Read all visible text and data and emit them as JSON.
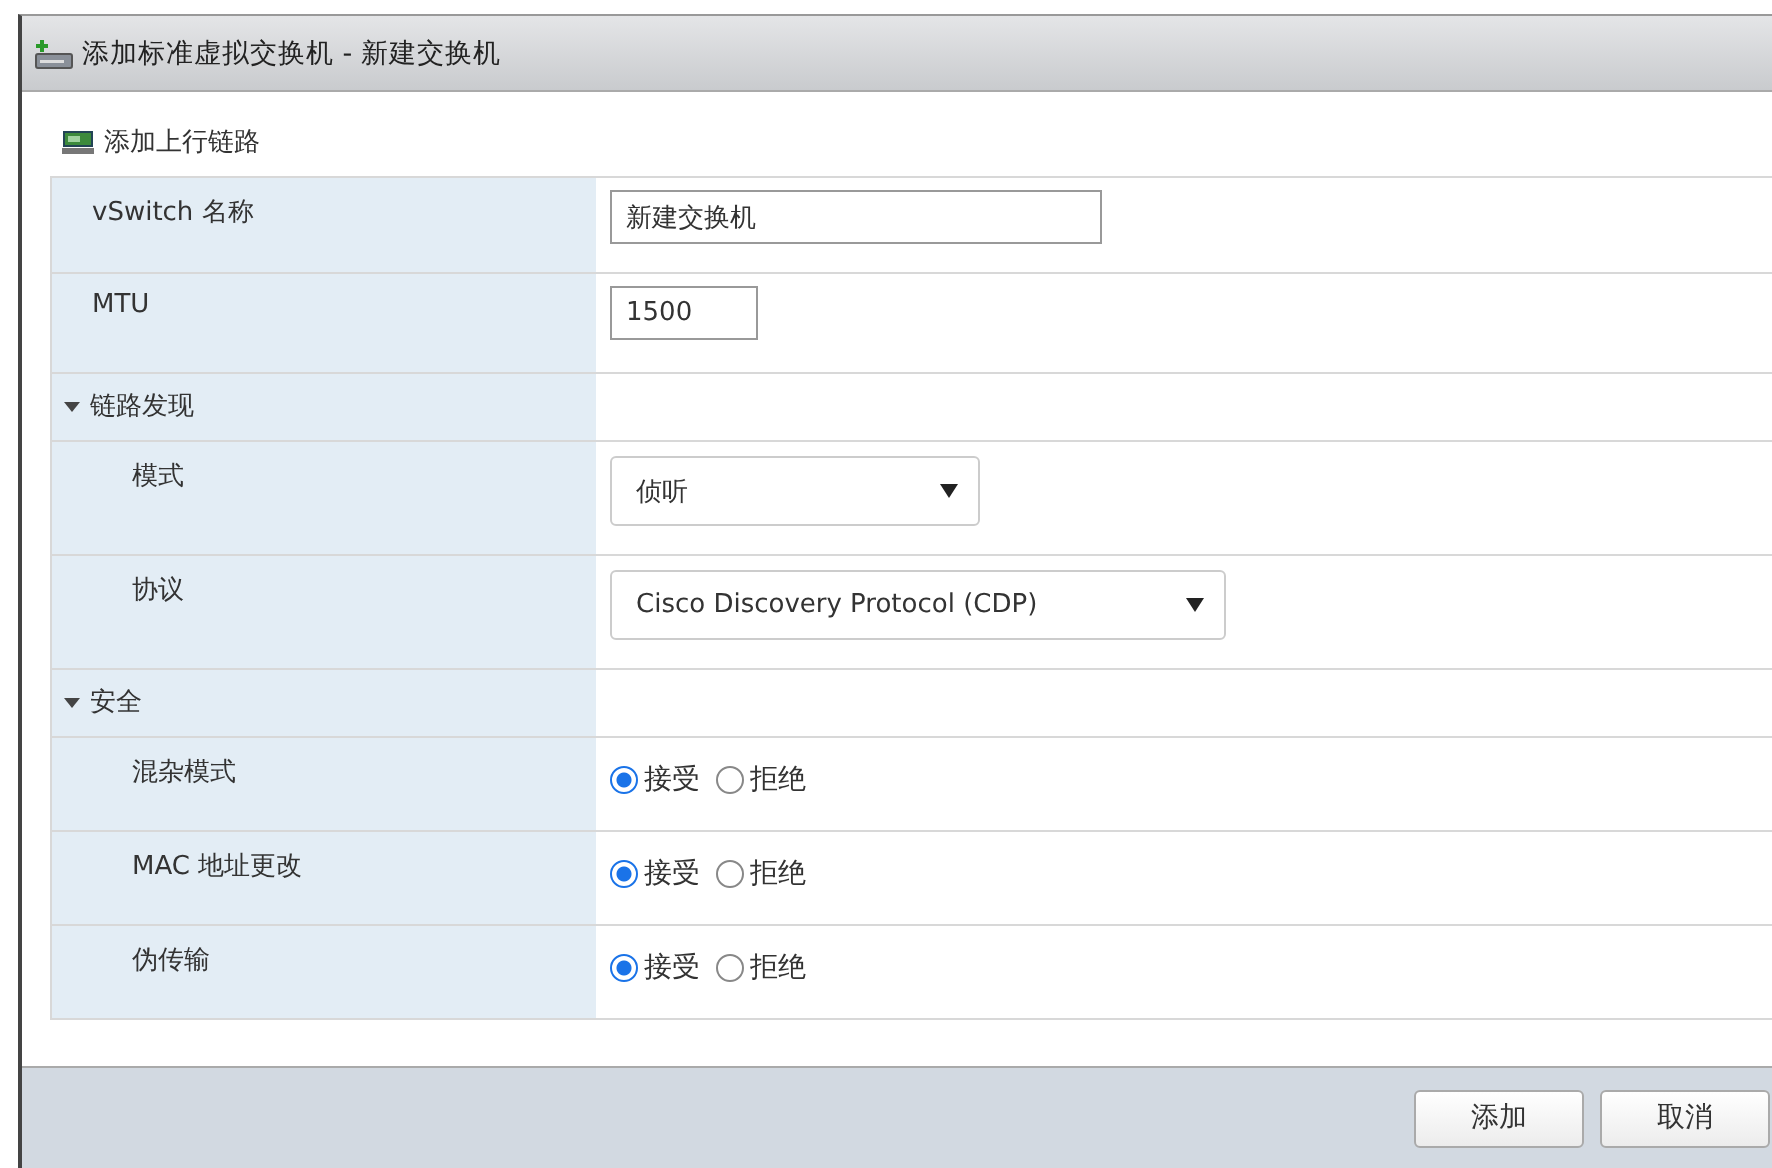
{
  "window": {
    "title": "添加标准虚拟交换机 - 新建交换机"
  },
  "toolbar": {
    "add_uplink": "添加上行链路"
  },
  "rows": [
    {
      "kind": "text",
      "label": "vSwitch 名称",
      "value": "新建交换机"
    },
    {
      "kind": "text",
      "label": "MTU",
      "value": "1500"
    },
    {
      "kind": "section",
      "label": "链路发现",
      "expanded": true
    },
    {
      "kind": "select",
      "label": "模式",
      "value": "侦听"
    },
    {
      "kind": "select",
      "label": "协议",
      "value": "Cisco Discovery Protocol (CDP)"
    },
    {
      "kind": "section",
      "label": "安全",
      "expanded": true
    },
    {
      "kind": "radio",
      "label": "混杂模式",
      "options": [
        {
          "label": "接受",
          "selected": true
        },
        {
          "label": "拒绝",
          "selected": false
        }
      ]
    },
    {
      "kind": "radio",
      "label": "MAC 地址更改",
      "options": [
        {
          "label": "接受",
          "selected": true
        },
        {
          "label": "拒绝",
          "selected": false
        }
      ]
    },
    {
      "kind": "radio",
      "label": "伪传输",
      "options": [
        {
          "label": "接受",
          "selected": true
        },
        {
          "label": "拒绝",
          "selected": false
        }
      ]
    }
  ],
  "buttons": [
    "添加",
    "取消"
  ]
}
